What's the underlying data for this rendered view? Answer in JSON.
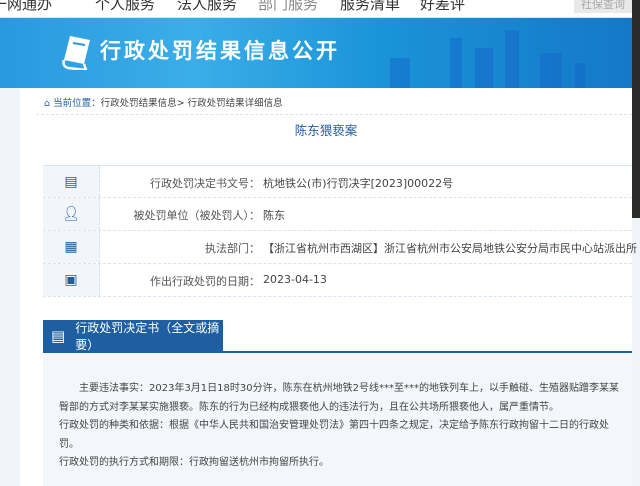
{
  "topnav": {
    "items": [
      "一网通办",
      "个人服务",
      "法人服务",
      "部门服务",
      "服务清单",
      "好差评"
    ],
    "right_button": "社保查询"
  },
  "banner": {
    "title": "行政处罚结果信息公开"
  },
  "breadcrumb": {
    "label": "当前位置",
    "sep": "：",
    "items": [
      "行政处罚结果信息>",
      "行政处罚结果详细信息"
    ]
  },
  "case_title": "陈东猥亵案",
  "fields": [
    {
      "icon": "document-icon",
      "label": "行政处罚决定书文号：",
      "value": "杭地铁公(市)行罚决字[2023]00022号"
    },
    {
      "icon": "person-icon",
      "label": "被处罚单位（被处罚人）：",
      "value": "陈东"
    },
    {
      "icon": "building-icon",
      "label": "执法部门：",
      "value": "【浙江省杭州市西湖区】浙江省杭州市公安局地铁公安分局市民中心站派出所"
    },
    {
      "icon": "calendar-clock-icon",
      "label": "作出行政处罚的日期：",
      "value": "2023-04-13"
    }
  ],
  "section": {
    "title": "行政处罚决定书（全文或摘要）",
    "lines": [
      "　　主要违法事实：2023年3月1日18时30分许，陈东在杭州地铁2号线***至***的地铁列车上，以手触碰、生殖器贴蹭李某某",
      "臀部的方式对李某某实施猥亵。陈东的行为已经构成猥亵他人的违法行为，且在公共场所猥亵他人，属严重情节。",
      "行政处罚的种类和依据：根据《中华人民共和国治安管理处罚法》第四十四条之规定，决定给予陈东行政拘留十二日的行政处",
      "罚。",
      "行政处罚的执行方式和期限：行政拘留送杭州市拘留所执行。"
    ]
  }
}
